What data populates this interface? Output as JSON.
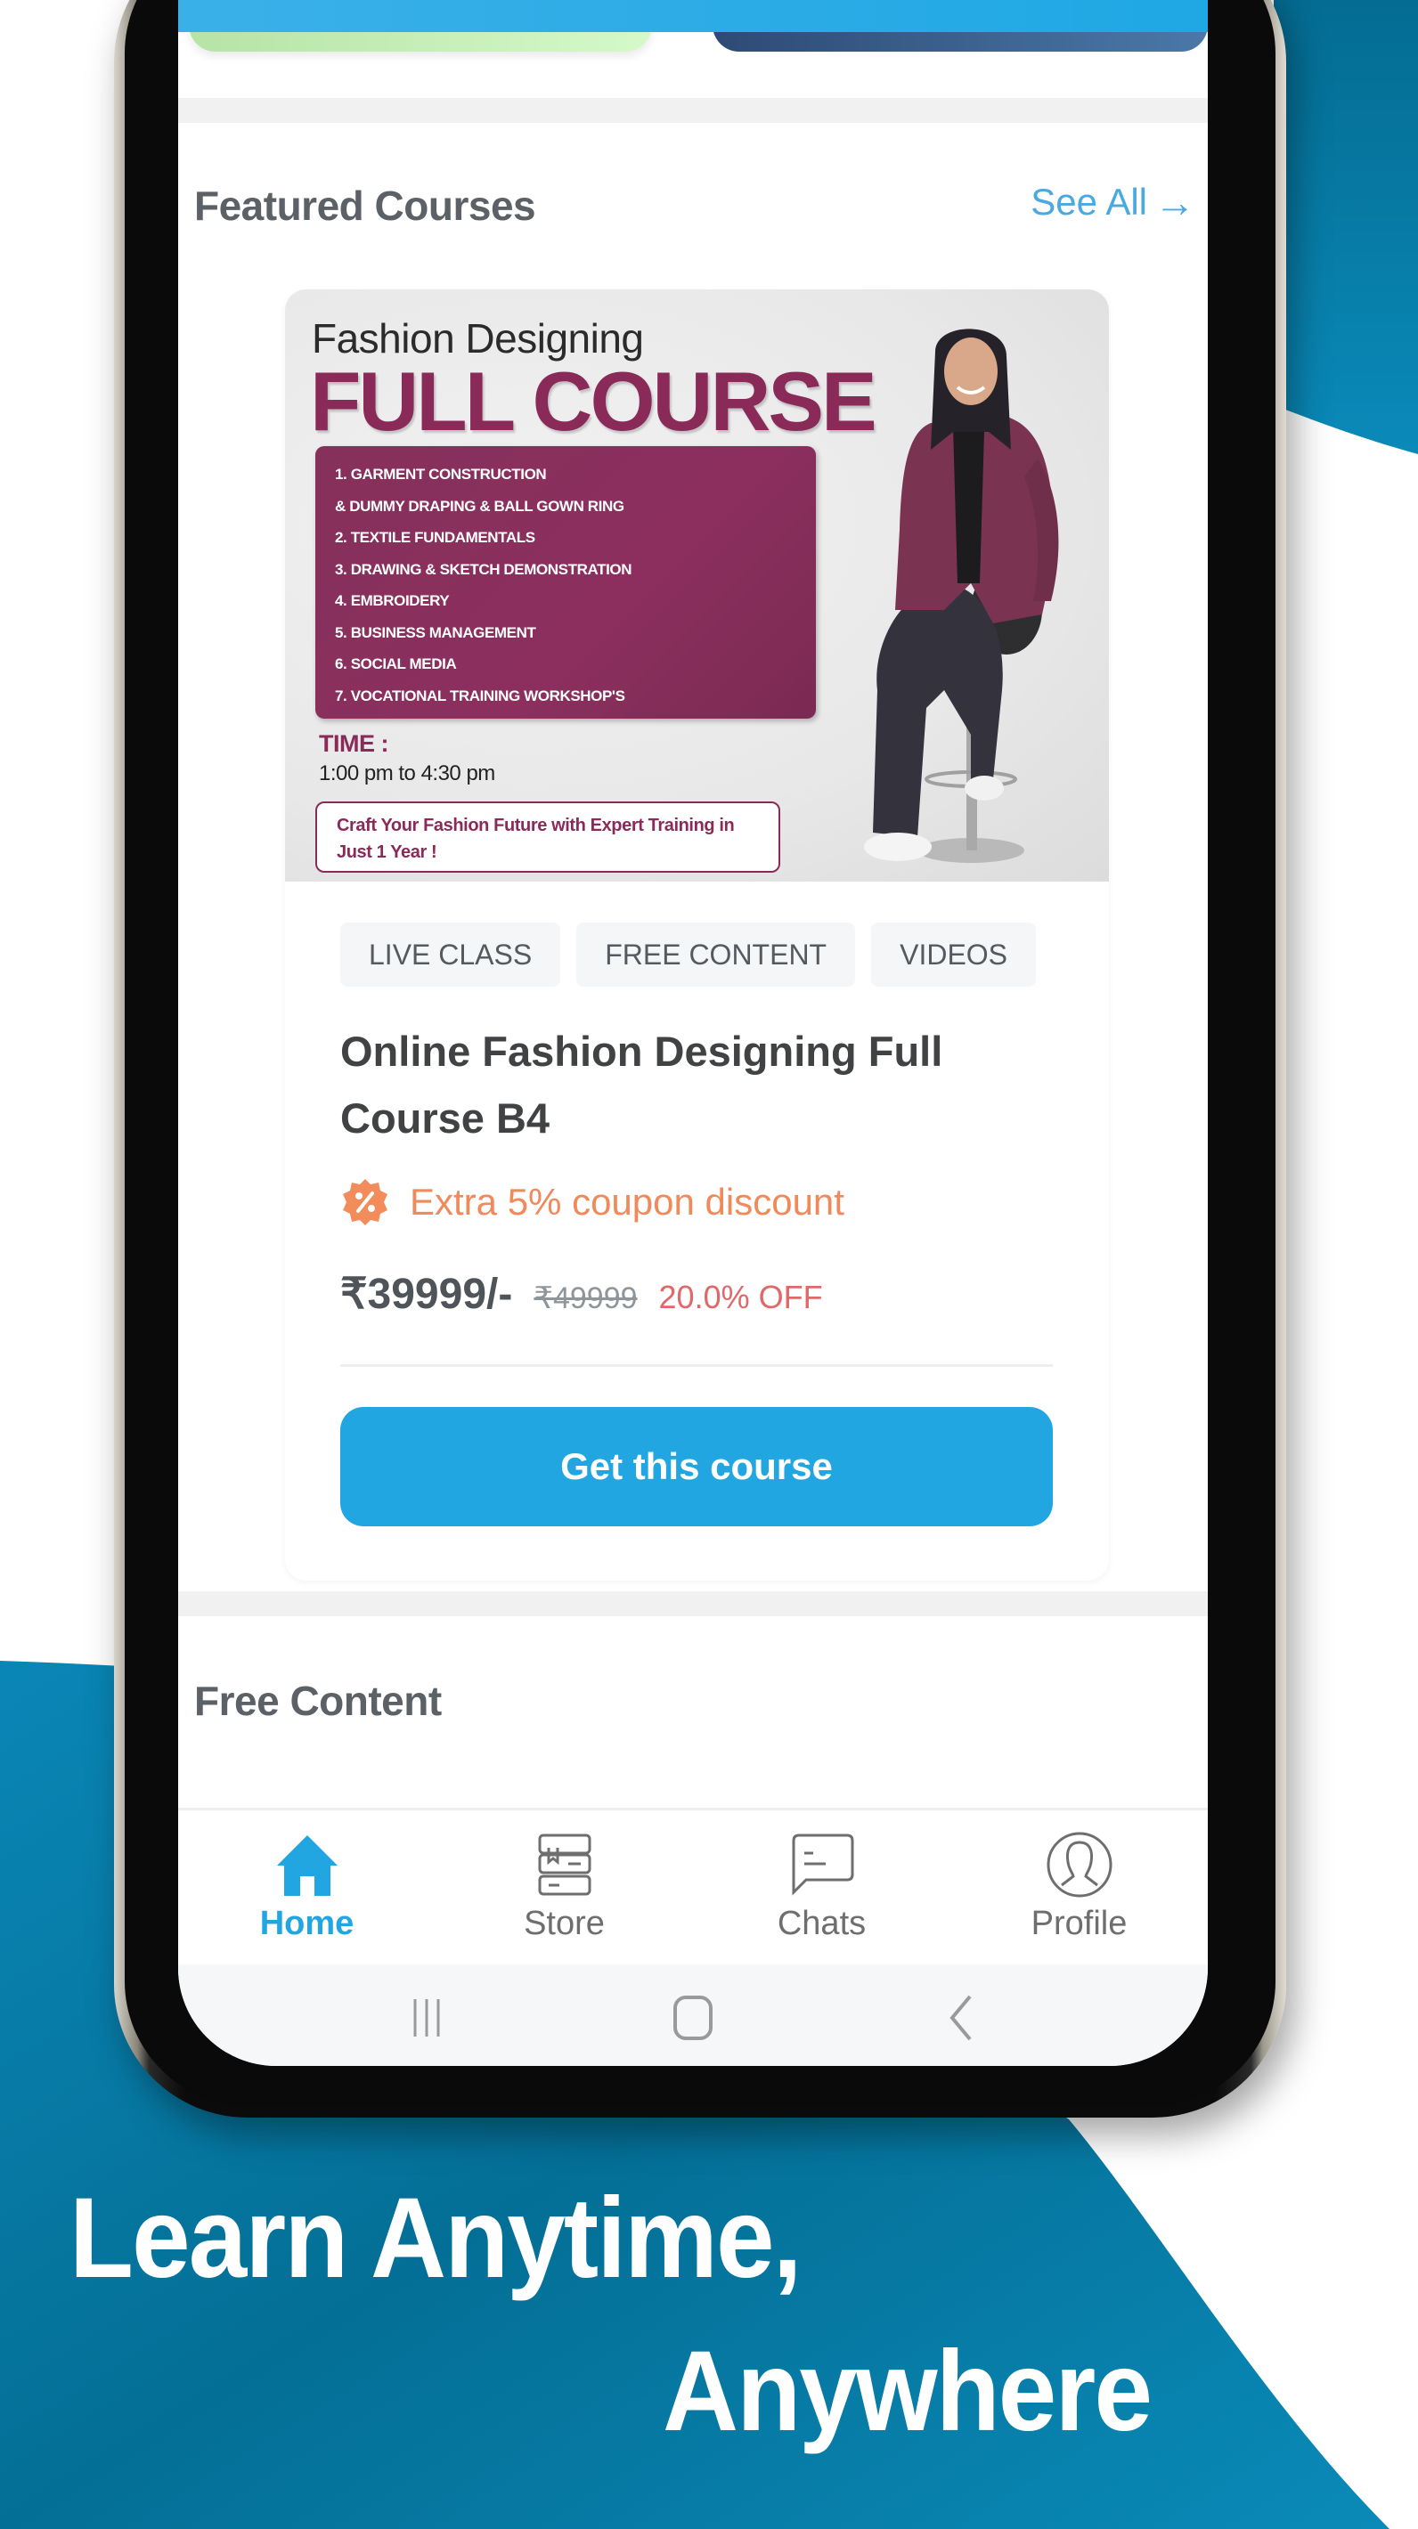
{
  "colors": {
    "brand_blue": "#22a6e2",
    "background_teal": "#046f96",
    "course_magenta": "#8a2a59",
    "coupon_orange": "#f08a5b",
    "discount_red": "#e06868"
  },
  "featured": {
    "title": "Featured Courses",
    "see_all_label": "See All",
    "see_all_icon": "arrow-right-icon"
  },
  "course": {
    "thumbnail": {
      "kicker": "Fashion Designing",
      "headline": "FULL COURSE",
      "modules": [
        "1. GARMENT CONSTRUCTION",
        "& DUMMY DRAPING & BALL GOWN RING",
        "2. TEXTILE FUNDAMENTALS",
        "3. DRAWING & SKETCH DEMONSTRATION",
        "4. EMBROIDERY",
        "5. BUSINESS MANAGEMENT",
        "6. SOCIAL MEDIA",
        "7. VOCATIONAL TRAINING WORKSHOP'S"
      ],
      "time_label": "TIME :",
      "time_value": "1:00 pm to 4:30 pm",
      "tagline": "Craft Your Fashion Future with Expert Training in Just 1 Year !"
    },
    "tags": [
      "LIVE CLASS",
      "FREE CONTENT",
      "VIDEOS"
    ],
    "title": "Online Fashion Designing Full Course B4",
    "coupon_icon": "discount-badge-icon",
    "coupon_text": "Extra 5% coupon discount",
    "price_current": "₹39999/-",
    "price_original": "₹49999",
    "discount": "20.0% OFF",
    "cta_label": "Get this course"
  },
  "free_content": {
    "title": "Free Content"
  },
  "bottom_nav": {
    "items": [
      {
        "label": "Home",
        "icon": "home-icon",
        "active": true
      },
      {
        "label": "Store",
        "icon": "books-icon",
        "active": false
      },
      {
        "label": "Chats",
        "icon": "chat-bubble-icon",
        "active": false
      },
      {
        "label": "Profile",
        "icon": "user-profile-icon",
        "active": false
      }
    ]
  },
  "system_nav": {
    "recents_icon": "recents-icon",
    "home_icon": "system-home-icon",
    "back_icon": "back-icon"
  },
  "promo": {
    "line1": "Learn Anytime,",
    "line2": "Anywhere"
  }
}
